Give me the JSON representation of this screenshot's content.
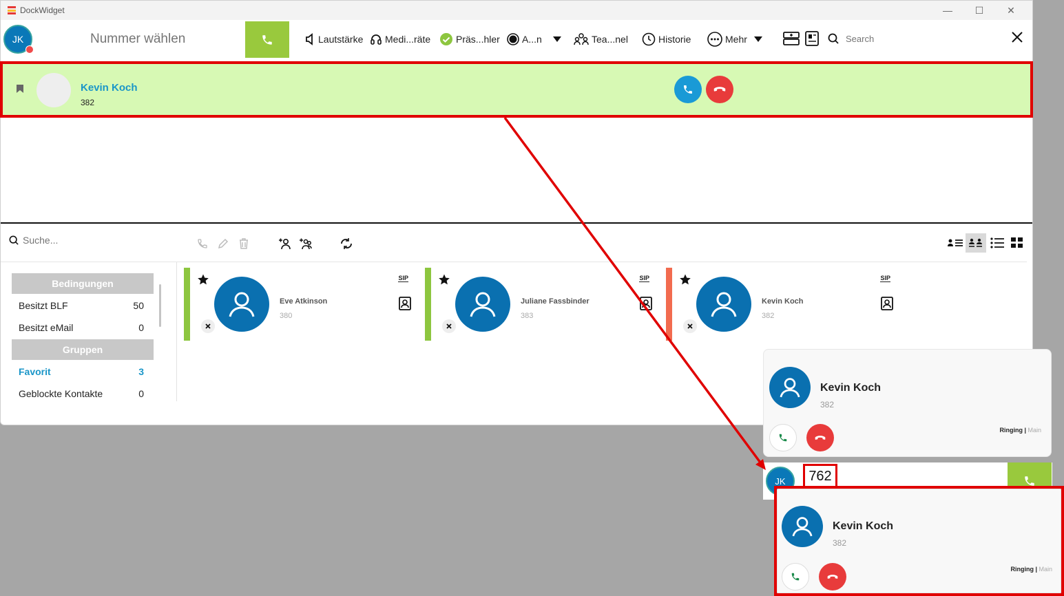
{
  "window": {
    "title": "DockWidget"
  },
  "toolbar": {
    "avatar_initials": "JK",
    "dial_placeholder": "Nummer wählen",
    "items": [
      {
        "label": "Lautstärke"
      },
      {
        "label": "Medi...räte"
      },
      {
        "label": "Präs...hler"
      },
      {
        "label": "A...n"
      },
      {
        "label": "Tea...nel"
      },
      {
        "label": "Historie"
      },
      {
        "label": "Mehr"
      }
    ],
    "search_placeholder": "Search"
  },
  "active_call": {
    "name": "Kevin Koch",
    "number": "382"
  },
  "contacts": {
    "search_placeholder": "Suche...",
    "conditions_header": "Bedingungen",
    "conditions": [
      {
        "label": "Besitzt BLF",
        "count": "50"
      },
      {
        "label": "Besitzt eMail",
        "count": "0"
      }
    ],
    "groups_header": "Gruppen",
    "groups": [
      {
        "label": "Favorit",
        "count": "3"
      },
      {
        "label": "Geblockte Kontakte",
        "count": "0"
      }
    ],
    "cards": [
      {
        "name": "Eve Atkinson",
        "number": "380",
        "badge": "SIP",
        "status_color": "#8dc63f"
      },
      {
        "name": "Juliane Fassbinder",
        "number": "383",
        "badge": "SIP",
        "status_color": "#8dc63f"
      },
      {
        "name": "Kevin Koch",
        "number": "382",
        "badge": "SIP",
        "status_color": "#f26b4f"
      }
    ]
  },
  "popup1": {
    "name": "Kevin Koch",
    "number": "382",
    "status": "Ringing",
    "line": "Main"
  },
  "mini_bar": {
    "avatar_initials": "JK",
    "number": "762"
  },
  "popup2": {
    "name": "Kevin Koch",
    "number": "382",
    "status": "Ringing",
    "line": "Main"
  },
  "colors": {
    "accent_green": "#99c93d",
    "call_row_bg": "#d7f9b4",
    "name_blue": "#1a96c8",
    "avatar_blue": "#0a70b0",
    "reject_red": "#e83b3b",
    "annotation_red": "#e00000"
  }
}
